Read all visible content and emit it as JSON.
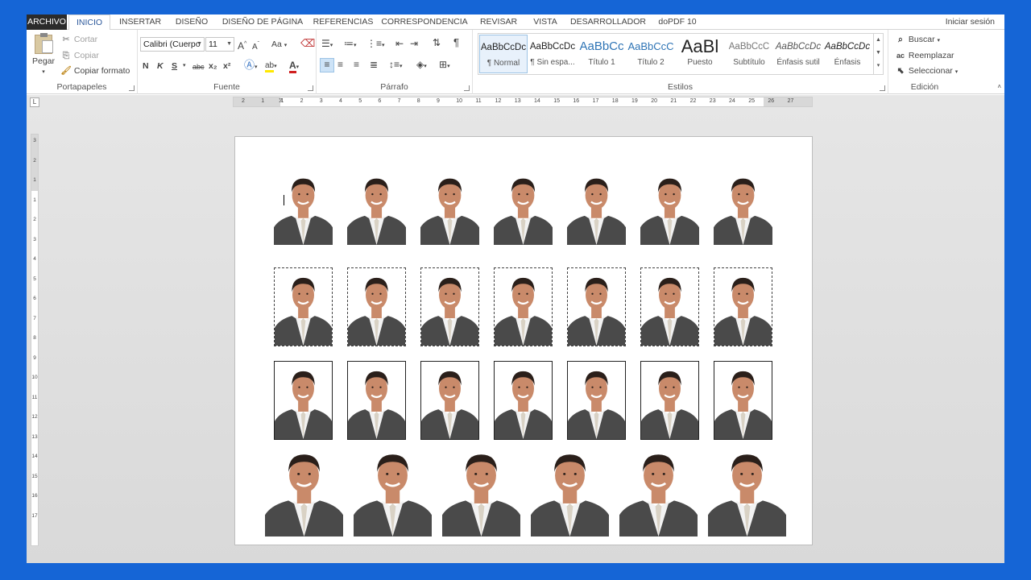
{
  "tabs": {
    "file": "ARCHIVO",
    "items": [
      "INICIO",
      "INSERTAR",
      "DISEÑO",
      "DISEÑO DE PÁGINA",
      "REFERENCIAS",
      "CORRESPONDENCIA",
      "REVISAR",
      "VISTA",
      "DESARROLLADOR",
      "doPDF 10"
    ],
    "active": "INICIO",
    "signin": "Iniciar sesión"
  },
  "clipboard": {
    "paste": "Pegar",
    "cut": "Cortar",
    "copy": "Copiar",
    "format_painter": "Copiar formato",
    "label": "Portapapeles"
  },
  "font": {
    "name": "Calibri (Cuerpo",
    "size": "11",
    "label": "Fuente",
    "bold": "N",
    "italic": "K",
    "underline": "S",
    "strike": "abc",
    "sub": "x₂",
    "sup": "x²",
    "change_case": "Aa"
  },
  "paragraph": {
    "label": "Párrafo"
  },
  "styles": {
    "label": "Estilos",
    "items": [
      {
        "sample": "AaBbCcDc",
        "name": "¶ Normal"
      },
      {
        "sample": "AaBbCcDc",
        "name": "¶ Sin espa..."
      },
      {
        "sample": "AaBbCc",
        "name": "Título 1"
      },
      {
        "sample": "AaBbCcC",
        "name": "Título 2"
      },
      {
        "sample": "AaBl",
        "name": "Puesto"
      },
      {
        "sample": "AaBbCcC",
        "name": "Subtítulo"
      },
      {
        "sample": "AaBbCcDc",
        "name": "Énfasis sutil"
      },
      {
        "sample": "AaBbCcDc",
        "name": "Énfasis"
      }
    ]
  },
  "editing": {
    "label": "Edición",
    "find": "Buscar",
    "replace": "Reemplazar",
    "select": "Seleccionar"
  },
  "ruler": {
    "h_numbers": [
      "2",
      "1",
      "1",
      "2",
      "3",
      "4",
      "5",
      "6",
      "7",
      "8",
      "9",
      "10",
      "11",
      "12",
      "13",
      "14",
      "15",
      "16",
      "17",
      "18",
      "19",
      "20",
      "21",
      "22",
      "23",
      "24",
      "25",
      "26",
      "27"
    ],
    "v_numbers": [
      "3",
      "2",
      "1",
      "1",
      "2",
      "3",
      "4",
      "5",
      "6",
      "7",
      "8",
      "9",
      "10",
      "11",
      "12",
      "13",
      "14",
      "15",
      "16",
      "17"
    ],
    "tab_selector": "L"
  },
  "document": {
    "rows": [
      {
        "count": 7,
        "border": "none"
      },
      {
        "count": 7,
        "border": "dashed"
      },
      {
        "count": 7,
        "border": "solid"
      },
      {
        "count": 6,
        "border": "none"
      }
    ]
  },
  "colors": {
    "accent": "#2b579a",
    "frame": "#1565d6",
    "suit": "#4a4a4a",
    "skin": "#c98a6a",
    "hair": "#2a1f1a"
  }
}
